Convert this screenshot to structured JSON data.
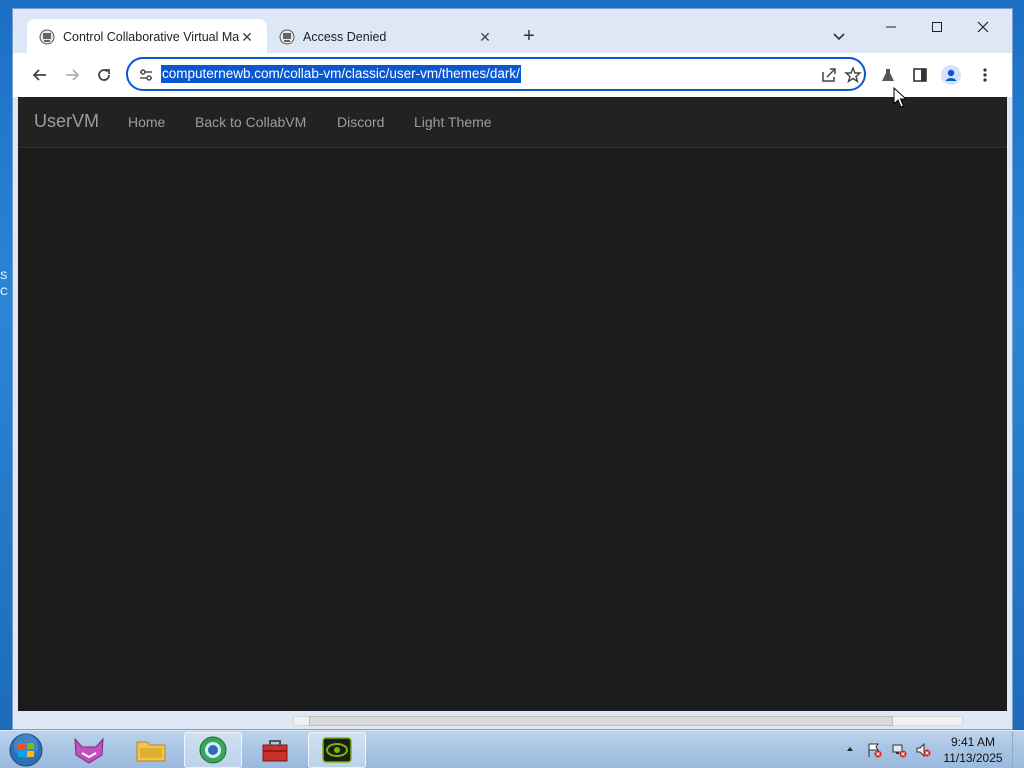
{
  "browser": {
    "tabs": [
      {
        "title": "Control Collaborative Virtual Ma",
        "active": true
      },
      {
        "title": "Access Denied",
        "active": false
      }
    ],
    "newtab_symbol": "+",
    "url": "computernewb.com/collab-vm/classic/user-vm/themes/dark/",
    "accent": "#0b57d0"
  },
  "site": {
    "brand": "UserVM",
    "nav": [
      "Home",
      "Back to CollabVM",
      "Discord",
      "Light Theme"
    ],
    "background": "#1b1b1c"
  },
  "taskbar": {
    "clock_time": "9:41 AM",
    "clock_date": "11/13/2025"
  },
  "desktop": {
    "peek_text": "S C"
  }
}
